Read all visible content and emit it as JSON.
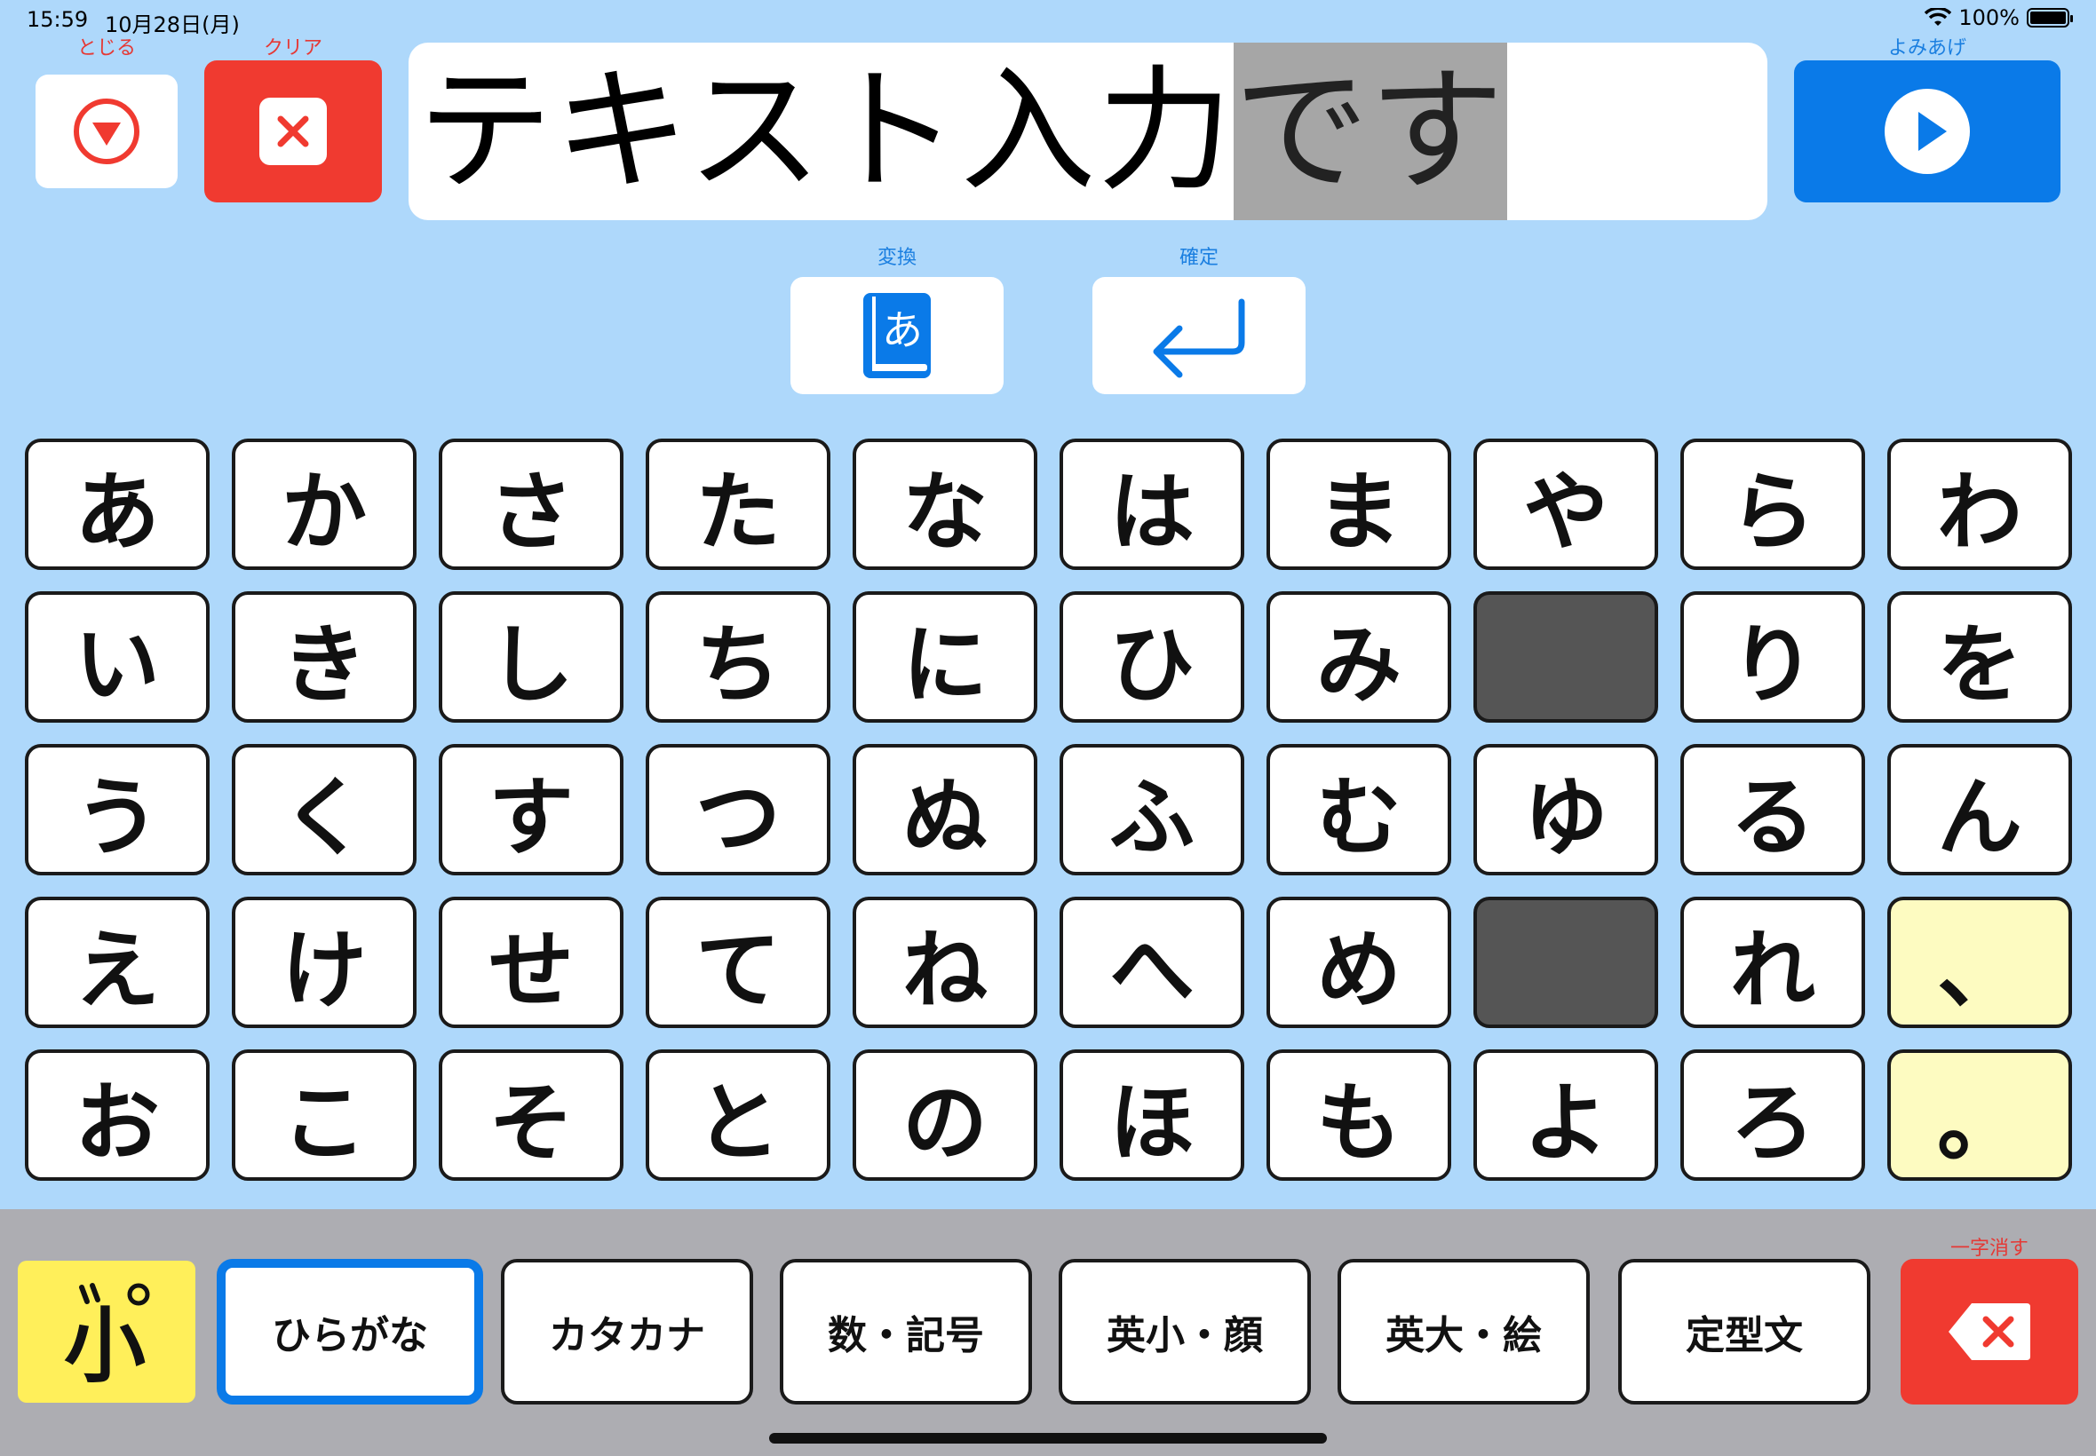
{
  "status_bar": {
    "time": "15:59",
    "date": "10月28日(月)",
    "battery": "100%"
  },
  "top": {
    "close_label": "とじる",
    "clear_label": "クリア",
    "speak_label": "よみあげ",
    "text_confirmed": "テキスト入力",
    "text_pending": "です"
  },
  "mid": {
    "convert_label": "変換",
    "confirm_label": "確定",
    "convert_icon_char": "あ"
  },
  "keyboard": {
    "columns": [
      [
        "あ",
        "い",
        "う",
        "え",
        "お"
      ],
      [
        "か",
        "き",
        "く",
        "け",
        "こ"
      ],
      [
        "さ",
        "し",
        "す",
        "せ",
        "そ"
      ],
      [
        "た",
        "ち",
        "つ",
        "て",
        "と"
      ],
      [
        "な",
        "に",
        "ぬ",
        "ね",
        "の"
      ],
      [
        "は",
        "ひ",
        "ふ",
        "へ",
        "ほ"
      ],
      [
        "ま",
        "み",
        "む",
        "め",
        "も"
      ],
      [
        "や",
        "",
        "ゆ",
        "",
        "よ"
      ],
      [
        "ら",
        "り",
        "る",
        "れ",
        "ろ"
      ],
      [
        "わ",
        "を",
        "ん",
        "、",
        "。"
      ]
    ]
  },
  "bottom": {
    "dakuten_key": "゛小゜",
    "modes": [
      "ひらがな",
      "カタカナ",
      "数・記号",
      "英小・顔",
      "英大・絵",
      "定型文"
    ],
    "active_mode": "ひらがな",
    "delete_label": "一字消す"
  },
  "colors": {
    "background": "#aed8fb",
    "accent_blue": "#0a7ae8",
    "danger_red": "#f03a30",
    "punct_key": "#fdfbc1",
    "dakuten_key": "#ffef5a"
  }
}
